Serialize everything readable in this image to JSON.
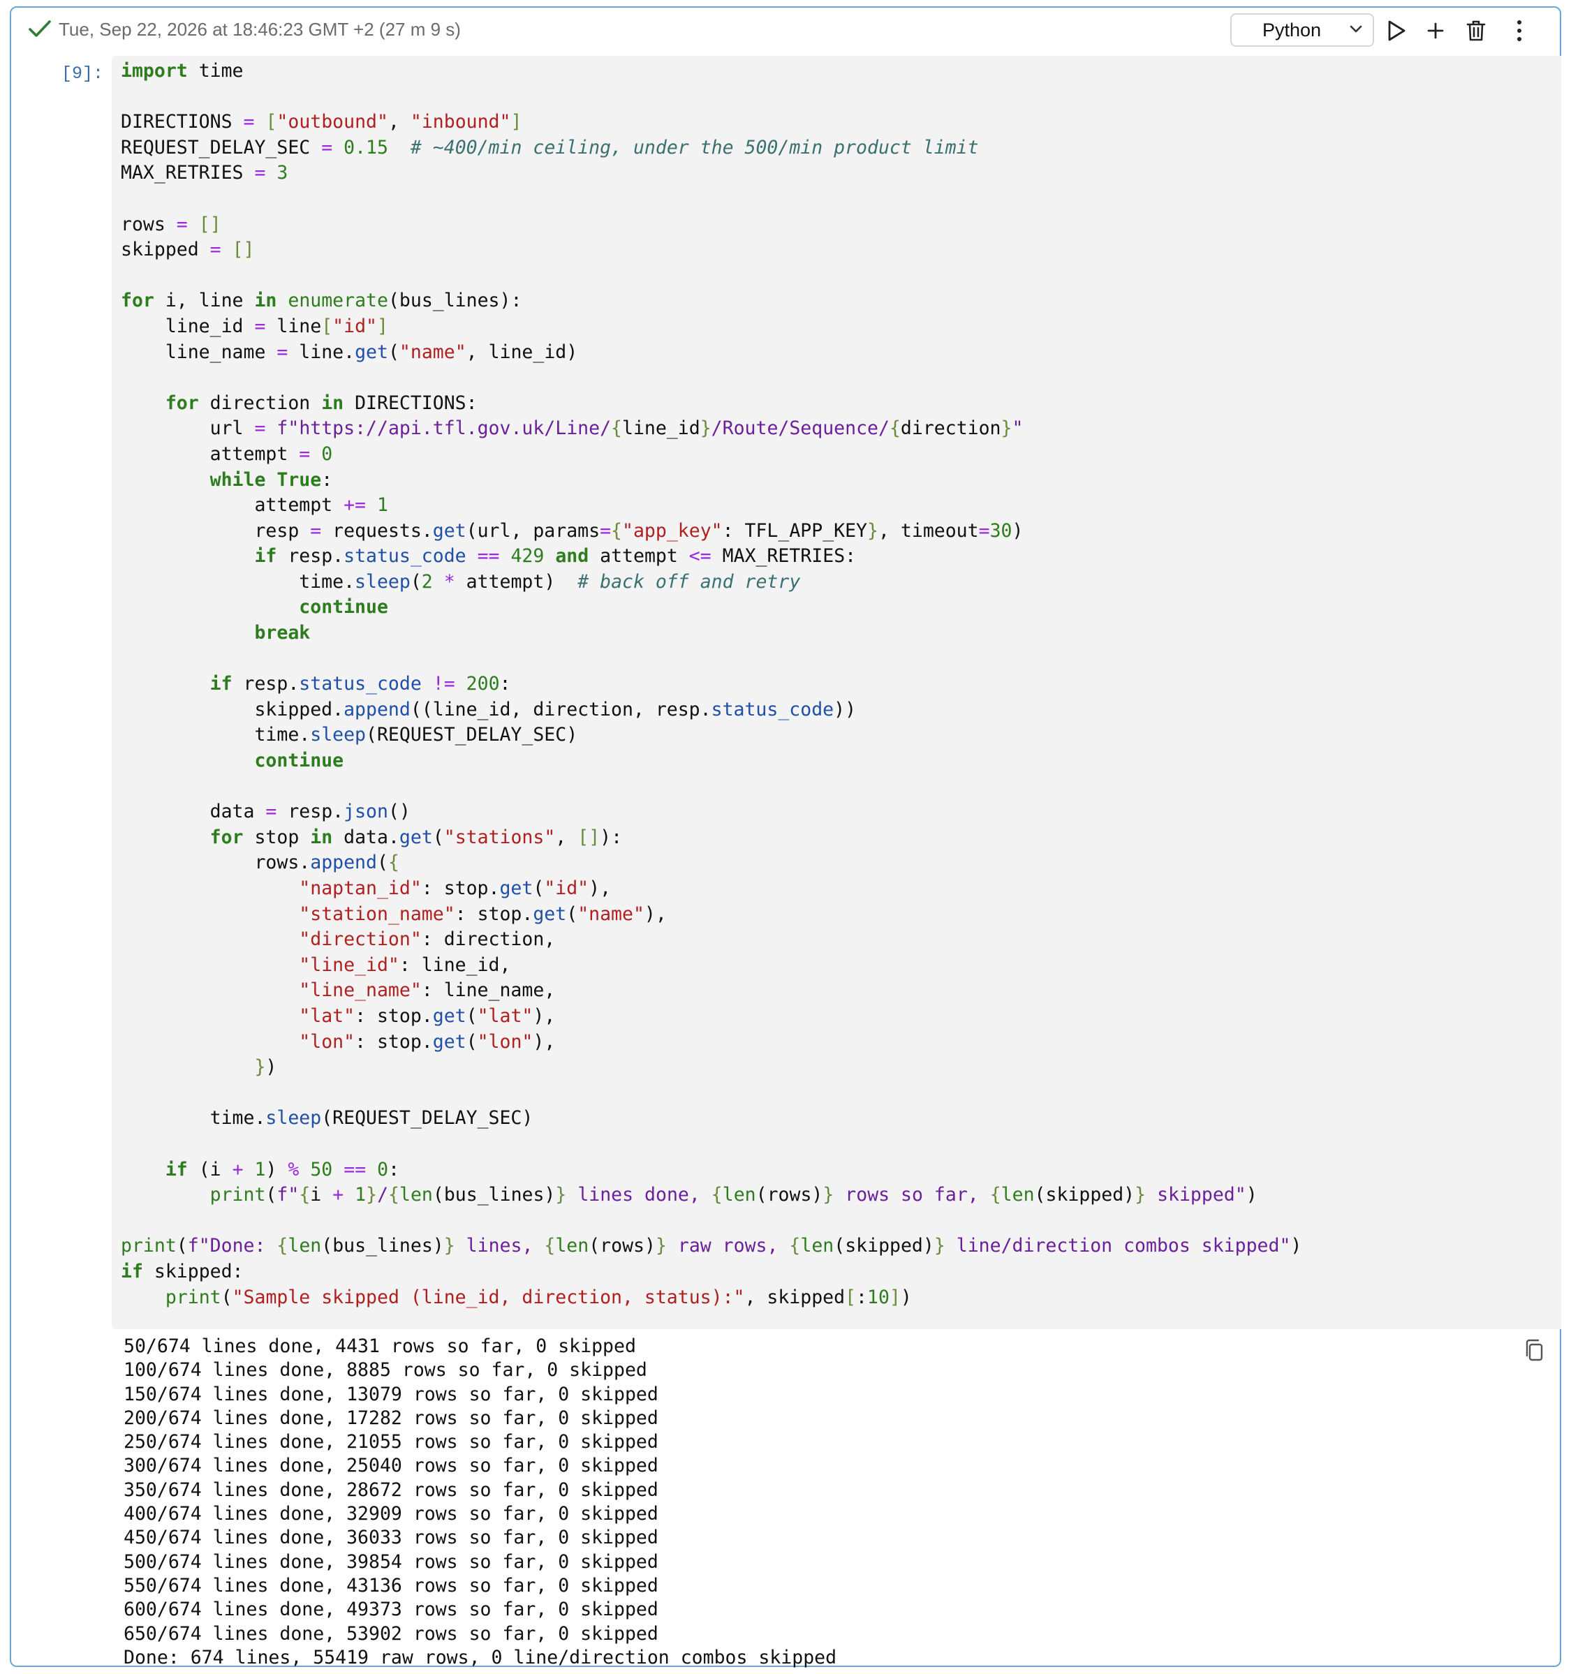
{
  "cell": {
    "status_icon": "checkmark-icon",
    "execution_info": "Tue, Sep 22, 2026 at 18:46:23 GMT +2 (27 m 9 s)",
    "execution_count": "[9]:",
    "kernel": "Python",
    "toolbar_icons": [
      "chevron-down-icon",
      "run-icon",
      "add-icon",
      "delete-icon",
      "more-icon",
      "copy-icon"
    ],
    "colors": {
      "border": "#6aa6da",
      "code_bg": "#f3f3f3",
      "keyword": "#2d7d1e",
      "operator": "#9c27e0",
      "string": "#b02020",
      "prompt": "#3b6ea8"
    }
  },
  "code": [
    "import time",
    "",
    "DIRECTIONS = [\"outbound\", \"inbound\"]",
    "REQUEST_DELAY_SEC = 0.15  # ~400/min ceiling, under the 500/min product limit",
    "MAX_RETRIES = 3",
    "",
    "rows = []",
    "skipped = []",
    "",
    "for i, line in enumerate(bus_lines):",
    "    line_id = line[\"id\"]",
    "    line_name = line.get(\"name\", line_id)",
    "",
    "    for direction in DIRECTIONS:",
    "        url = f\"https://api.tfl.gov.uk/Line/{line_id}/Route/Sequence/{direction}\"",
    "        attempt = 0",
    "        while True:",
    "            attempt += 1",
    "            resp = requests.get(url, params={\"app_key\": TFL_APP_KEY}, timeout=30)",
    "            if resp.status_code == 429 and attempt <= MAX_RETRIES:",
    "                time.sleep(2 * attempt)  # back off and retry",
    "                continue",
    "            break",
    "",
    "        if resp.status_code != 200:",
    "            skipped.append((line_id, direction, resp.status_code))",
    "            time.sleep(REQUEST_DELAY_SEC)",
    "            continue",
    "",
    "        data = resp.json()",
    "        for stop in data.get(\"stations\", []):",
    "            rows.append({",
    "                \"naptan_id\": stop.get(\"id\"),",
    "                \"station_name\": stop.get(\"name\"),",
    "                \"direction\": direction,",
    "                \"line_id\": line_id,",
    "                \"line_name\": line_name,",
    "                \"lat\": stop.get(\"lat\"),",
    "                \"lon\": stop.get(\"lon\"),",
    "            })",
    "",
    "        time.sleep(REQUEST_DELAY_SEC)",
    "",
    "    if (i + 1) % 50 == 0:",
    "        print(f\"{i + 1}/{len(bus_lines)} lines done, {len(rows)} rows so far, {len(skipped)} skipped\")",
    "",
    "print(f\"Done: {len(bus_lines)} lines, {len(rows)} raw rows, {len(skipped)} line/direction combos skipped\")",
    "if skipped:",
    "    print(\"Sample skipped (line_id, direction, status):\", skipped[:10])"
  ],
  "output": [
    "50/674 lines done, 4431 rows so far, 0 skipped",
    "100/674 lines done, 8885 rows so far, 0 skipped",
    "150/674 lines done, 13079 rows so far, 0 skipped",
    "200/674 lines done, 17282 rows so far, 0 skipped",
    "250/674 lines done, 21055 rows so far, 0 skipped",
    "300/674 lines done, 25040 rows so far, 0 skipped",
    "350/674 lines done, 28672 rows so far, 0 skipped",
    "400/674 lines done, 32909 rows so far, 0 skipped",
    "450/674 lines done, 36033 rows so far, 0 skipped",
    "500/674 lines done, 39854 rows so far, 0 skipped",
    "550/674 lines done, 43136 rows so far, 0 skipped",
    "600/674 lines done, 49373 rows so far, 0 skipped",
    "650/674 lines done, 53902 rows so far, 0 skipped",
    "Done: 674 lines, 55419 raw rows, 0 line/direction combos skipped"
  ]
}
